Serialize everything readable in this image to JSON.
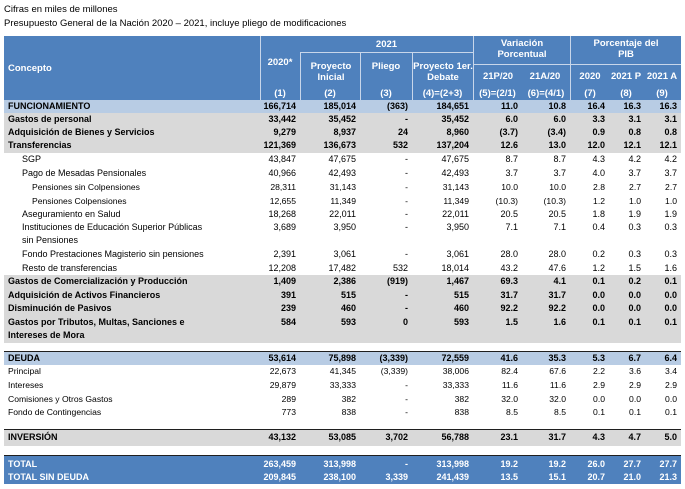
{
  "caption": {
    "line1": "Cifras en miles de millones",
    "line2": "Presupuesto General de la Nación 2020 – 2021, incluye pliego de modificaciones"
  },
  "header": {
    "concepto": "Concepto",
    "y2020": "2020*",
    "y2021": "2021",
    "proyecto_inicial": "Proyecto Inicial",
    "pliego": "Pliego",
    "proyecto_1er": "Proyecto 1er. Debate",
    "variacion": "Variación Porcentual",
    "porcentaje": "Porcentaje del PIB",
    "v21p20": "21P/20",
    "v21a20": "21A/20",
    "p2020": "2020",
    "p2021p": "2021 P",
    "p2021a": "2021 A",
    "n1": "(1)",
    "n2": "(2)",
    "n3": "(3)",
    "n4": "(4)=(2+3)",
    "n5": "(5)=(2/1)",
    "n6": "(6)=(4/1)",
    "n7": "(7)",
    "n8": "(8)",
    "n9": "(9)"
  },
  "rows": [
    {
      "label": "FUNCIONAMIENTO",
      "c1": "166,714",
      "c2": "185,014",
      "c3": "(363)",
      "c4": "184,651",
      "c5": "11.0",
      "c6": "10.8",
      "c7": "16.4",
      "c8": "16.3",
      "c9": "16.3"
    },
    {
      "label": "Gastos de personal",
      "c1": "33,442",
      "c2": "35,452",
      "c3": "-",
      "c4": "35,452",
      "c5": "6.0",
      "c6": "6.0",
      "c7": "3.3",
      "c8": "3.1",
      "c9": "3.1"
    },
    {
      "label": "Adquisición de Bienes y Servicios",
      "c1": "9,279",
      "c2": "8,937",
      "c3": "24",
      "c4": "8,960",
      "c5": "(3.7)",
      "c6": "(3.4)",
      "c7": "0.9",
      "c8": "0.8",
      "c9": "0.8"
    },
    {
      "label": "Transferencias",
      "c1": "121,369",
      "c2": "136,673",
      "c3": "532",
      "c4": "137,204",
      "c5": "12.6",
      "c6": "13.0",
      "c7": "12.0",
      "c8": "12.1",
      "c9": "12.1"
    },
    {
      "label": "SGP",
      "c1": "43,847",
      "c2": "47,675",
      "c3": "-",
      "c4": "47,675",
      "c5": "8.7",
      "c6": "8.7",
      "c7": "4.3",
      "c8": "4.2",
      "c9": "4.2"
    },
    {
      "label": "Pago de Mesadas Pensionales",
      "c1": "40,966",
      "c2": "42,493",
      "c3": "-",
      "c4": "42,493",
      "c5": "3.7",
      "c6": "3.7",
      "c7": "4.0",
      "c8": "3.7",
      "c9": "3.7"
    },
    {
      "label": "Pensiones sin Colpensiones",
      "c1": "28,311",
      "c2": "31,143",
      "c3": "-",
      "c4": "31,143",
      "c5": "10.0",
      "c6": "10.0",
      "c7": "2.8",
      "c8": "2.7",
      "c9": "2.7"
    },
    {
      "label": "Pensiones Colpensiones",
      "c1": "12,655",
      "c2": "11,349",
      "c3": "-",
      "c4": "11,349",
      "c5": "(10.3)",
      "c6": "(10.3)",
      "c7": "1.2",
      "c8": "1.0",
      "c9": "1.0"
    },
    {
      "label": "Aseguramiento en Salud",
      "c1": "18,268",
      "c2": "22,011",
      "c3": "-",
      "c4": "22,011",
      "c5": "20.5",
      "c6": "20.5",
      "c7": "1.8",
      "c8": "1.9",
      "c9": "1.9"
    },
    {
      "label": "Instituciones de Educación Superior Públicas",
      "c1": "3,689",
      "c2": "3,950",
      "c3": "-",
      "c4": "3,950",
      "c5": "7.1",
      "c6": "7.1",
      "c7": "0.4",
      "c8": "0.3",
      "c9": "0.3"
    },
    {
      "label": "sin Pensiones",
      "c1": "",
      "c2": "",
      "c3": "",
      "c4": "",
      "c5": "",
      "c6": "",
      "c7": "",
      "c8": "",
      "c9": ""
    },
    {
      "label": "Fondo Prestaciones Magisterio sin pensiones",
      "c1": "2,391",
      "c2": "3,061",
      "c3": "-",
      "c4": "3,061",
      "c5": "28.0",
      "c6": "28.0",
      "c7": "0.2",
      "c8": "0.3",
      "c9": "0.3"
    },
    {
      "label": "Resto de transferencias",
      "c1": "12,208",
      "c2": "17,482",
      "c3": "532",
      "c4": "18,014",
      "c5": "43.2",
      "c6": "47.6",
      "c7": "1.2",
      "c8": "1.5",
      "c9": "1.6"
    },
    {
      "label": "Gastos de Comercialización y Producción",
      "c1": "1,409",
      "c2": "2,386",
      "c3": "(919)",
      "c4": "1,467",
      "c5": "69.3",
      "c6": "4.1",
      "c7": "0.1",
      "c8": "0.2",
      "c9": "0.1"
    },
    {
      "label": "Adquisición de Activos Financieros",
      "c1": "391",
      "c2": "515",
      "c3": "-",
      "c4": "515",
      "c5": "31.7",
      "c6": "31.7",
      "c7": "0.0",
      "c8": "0.0",
      "c9": "0.0"
    },
    {
      "label": "Disminución de Pasivos",
      "c1": "239",
      "c2": "460",
      "c3": "-",
      "c4": "460",
      "c5": "92.2",
      "c6": "92.2",
      "c7": "0.0",
      "c8": "0.0",
      "c9": "0.0"
    },
    {
      "label": "Gastos por Tributos, Multas, Sanciones e",
      "c1": "584",
      "c2": "593",
      "c3": "0",
      "c4": "593",
      "c5": "1.5",
      "c6": "1.6",
      "c7": "0.1",
      "c8": "0.1",
      "c9": "0.1"
    },
    {
      "label": "Intereses de Mora",
      "c1": "",
      "c2": "",
      "c3": "",
      "c4": "",
      "c5": "",
      "c6": "",
      "c7": "",
      "c8": "",
      "c9": ""
    },
    {
      "label": "DEUDA",
      "c1": "53,614",
      "c2": "75,898",
      "c3": "(3,339)",
      "c4": "72,559",
      "c5": "41.6",
      "c6": "35.3",
      "c7": "5.3",
      "c8": "6.7",
      "c9": "6.4"
    },
    {
      "label": "Principal",
      "c1": "22,673",
      "c2": "41,345",
      "c3": "(3,339)",
      "c4": "38,006",
      "c5": "82.4",
      "c6": "67.6",
      "c7": "2.2",
      "c8": "3.6",
      "c9": "3.4"
    },
    {
      "label": "Intereses",
      "c1": "29,879",
      "c2": "33,333",
      "c3": "-",
      "c4": "33,333",
      "c5": "11.6",
      "c6": "11.6",
      "c7": "2.9",
      "c8": "2.9",
      "c9": "2.9"
    },
    {
      "label": "Comisiones y Otros Gastos",
      "c1": "289",
      "c2": "382",
      "c3": "-",
      "c4": "382",
      "c5": "32.0",
      "c6": "32.0",
      "c7": "0.0",
      "c8": "0.0",
      "c9": "0.0"
    },
    {
      "label": "Fondo de Contingencias",
      "c1": "773",
      "c2": "838",
      "c3": "-",
      "c4": "838",
      "c5": "8.5",
      "c6": "8.5",
      "c7": "0.1",
      "c8": "0.1",
      "c9": "0.1"
    },
    {
      "label": "INVERSIÓN",
      "c1": "43,132",
      "c2": "53,085",
      "c3": "3,702",
      "c4": "56,788",
      "c5": "23.1",
      "c6": "31.7",
      "c7": "4.3",
      "c8": "4.7",
      "c9": "5.0"
    },
    {
      "label": "TOTAL",
      "c1": "263,459",
      "c2": "313,998",
      "c3": "-",
      "c4": "313,998",
      "c5": "19.2",
      "c6": "19.2",
      "c7": "26.0",
      "c8": "27.7",
      "c9": "27.7"
    },
    {
      "label": "TOTAL SIN DEUDA",
      "c1": "209,845",
      "c2": "238,100",
      "c3": "3,339",
      "c4": "241,439",
      "c5": "13.5",
      "c6": "15.1",
      "c7": "20.7",
      "c8": "21.0",
      "c9": "21.3"
    }
  ]
}
